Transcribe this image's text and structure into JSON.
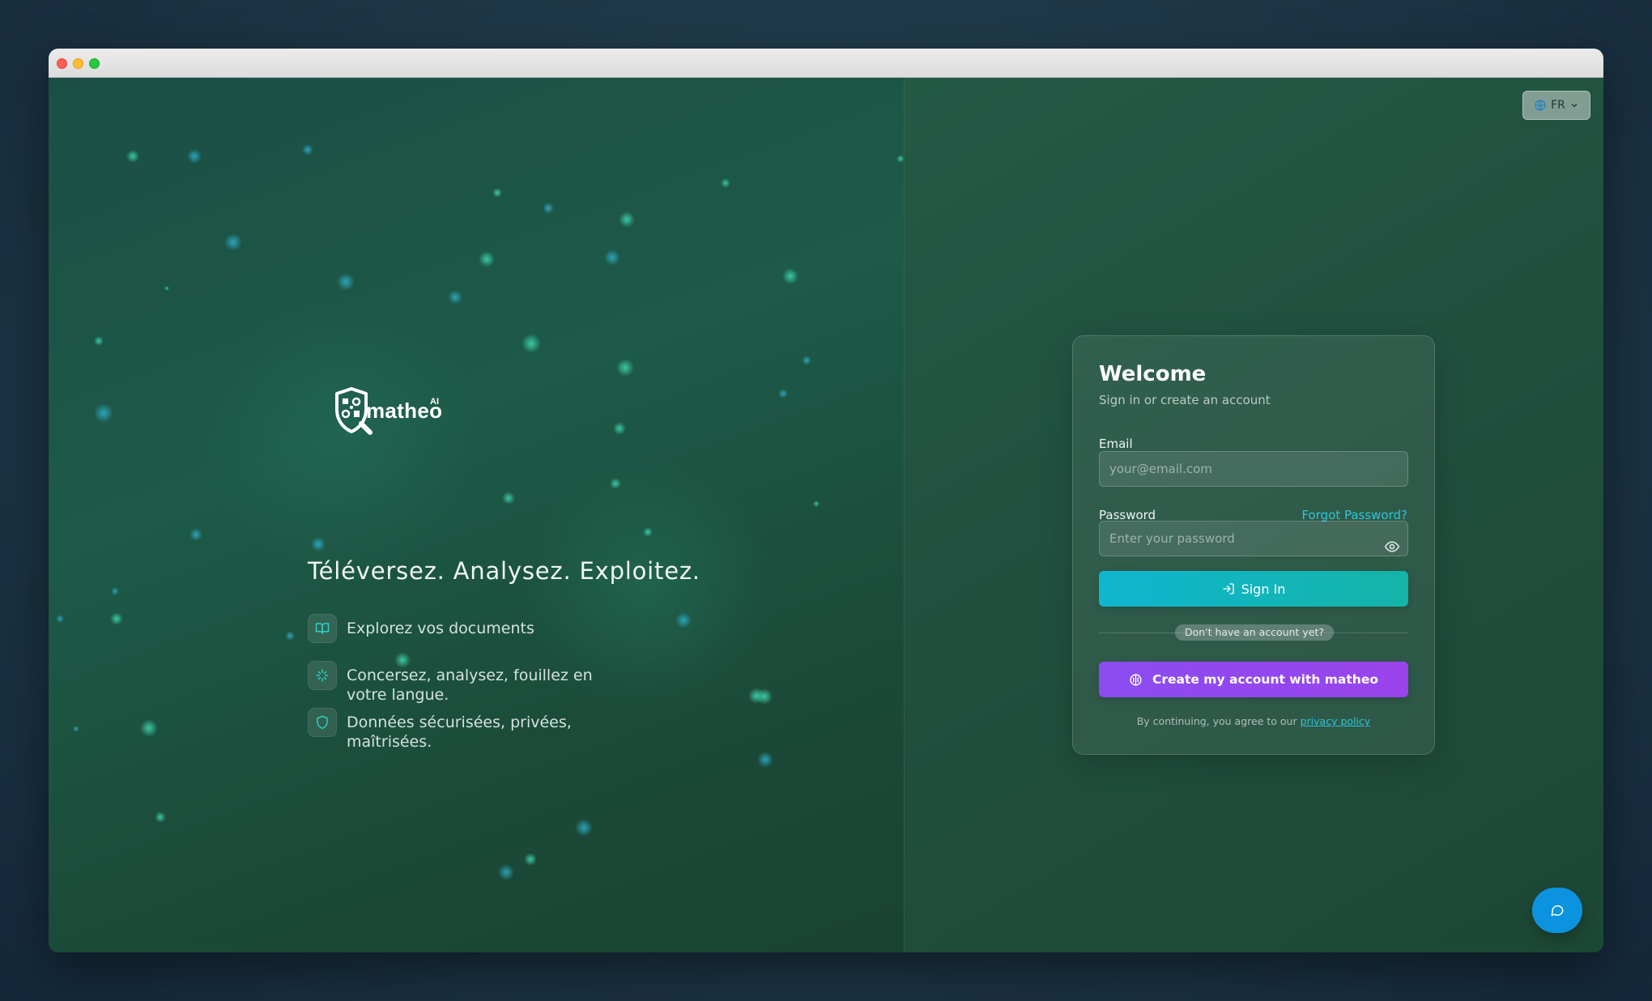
{
  "window": {
    "traffic_lights": [
      "close",
      "minimize",
      "maximize"
    ]
  },
  "brand": {
    "name": "matheo",
    "superscript": "AI"
  },
  "hero": {
    "tagline": "Téléversez. Analysez. Exploitez.",
    "features": [
      {
        "icon": "book-open-icon",
        "text": "Explorez vos documents"
      },
      {
        "icon": "sparkles-icon",
        "text": "Concersez, analysez, fouillez en votre langue."
      },
      {
        "icon": "shield-icon",
        "text": "Données sécurisées, privées, maîtrisées."
      }
    ]
  },
  "language": {
    "selected": "FR",
    "icon": "globe-icon"
  },
  "login": {
    "title": "Welcome",
    "subtitle": "Sign in or create an account",
    "email_label": "Email",
    "email_placeholder": "your@email.com",
    "password_label": "Password",
    "forgot_password": "Forgot Password?",
    "password_placeholder": "Enter your password",
    "sign_in": "Sign In",
    "divider_text": "Don't have an account yet?",
    "create_account": "Create my account with matheo",
    "legal_prefix": "By continuing, you agree to our",
    "privacy_link": "privacy policy"
  },
  "colors": {
    "sign_in_gradient": [
      "#0fb6cf",
      "#15b4a8"
    ],
    "create_gradient": [
      "#8b4cf0",
      "#9a43ec"
    ],
    "accent_link": "#2fc6d6",
    "chat_button": "#0c93e0"
  },
  "chat": {
    "icon": "chat-bubble-icon"
  }
}
